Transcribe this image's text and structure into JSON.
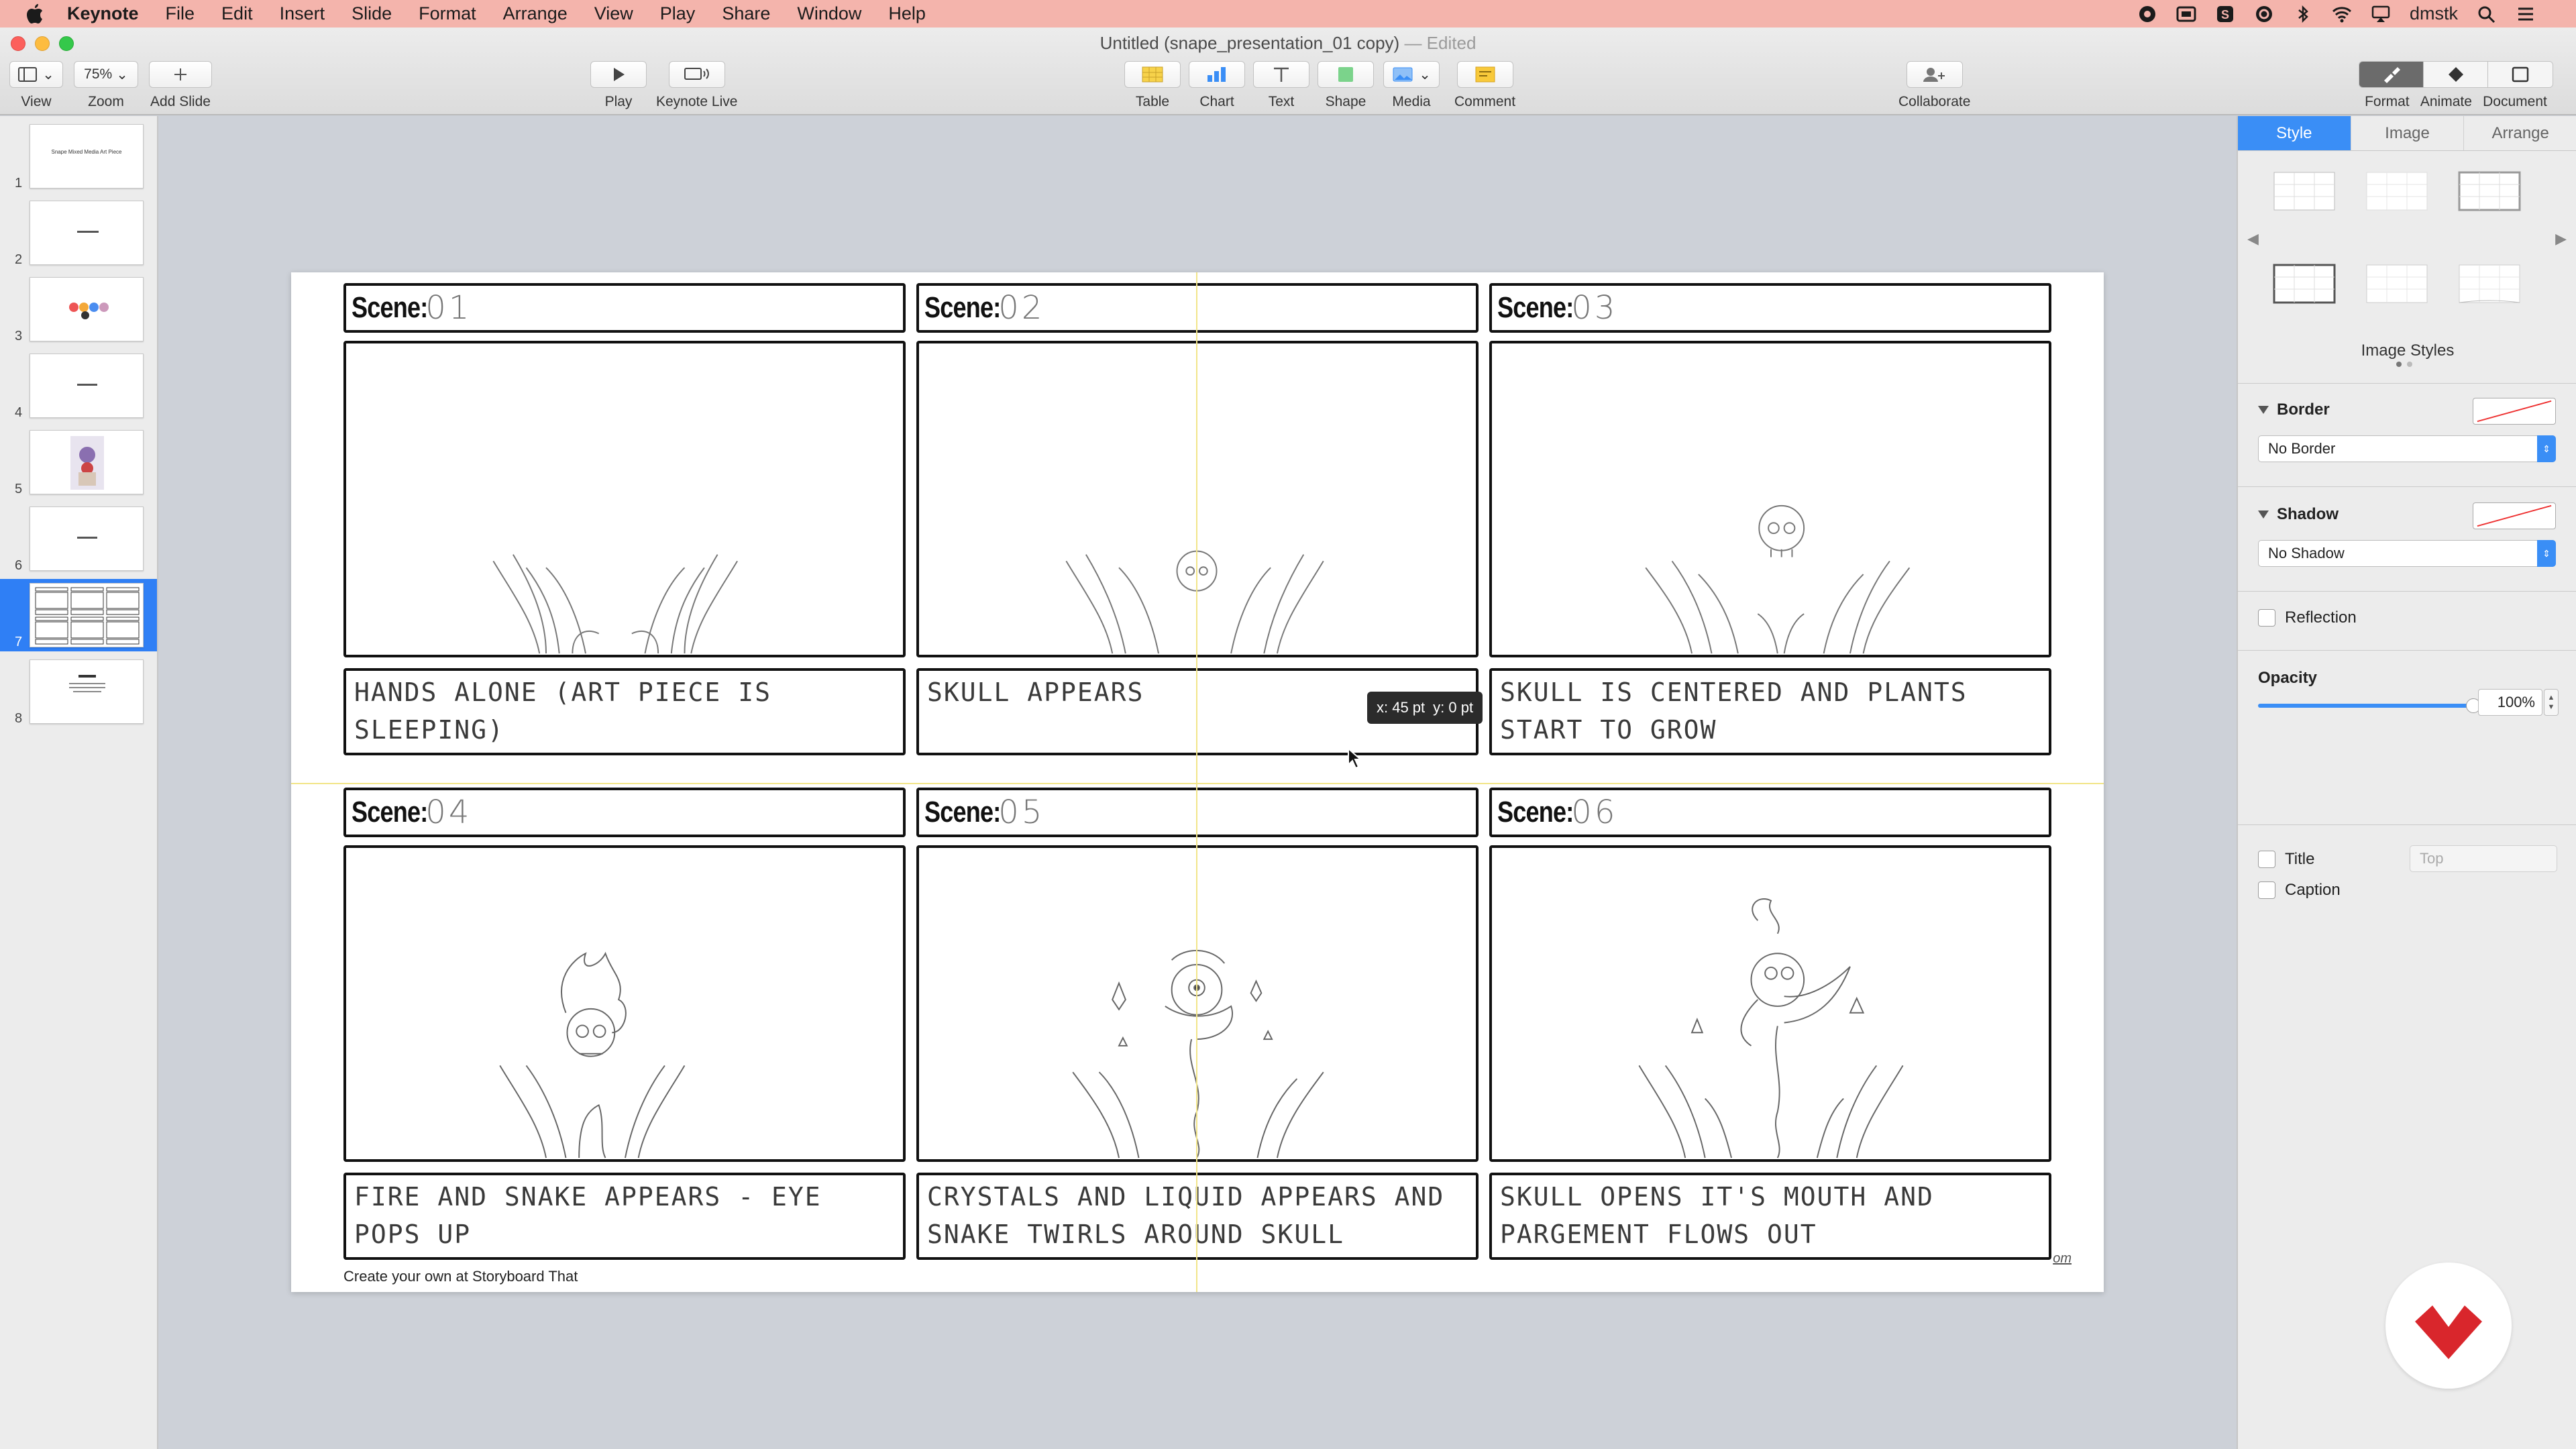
{
  "menubar": {
    "app_name": "Keynote",
    "items": [
      "File",
      "Edit",
      "Insert",
      "Slide",
      "Format",
      "Arrange",
      "View",
      "Play",
      "Share",
      "Window",
      "Help"
    ],
    "user": "dmstk"
  },
  "window": {
    "title": "Untitled (snape_presentation_01 copy)",
    "edited_suffix": "— Edited"
  },
  "toolbar": {
    "view_label": "View",
    "zoom_value": "75%",
    "zoom_label": "Zoom",
    "add_slide_label": "Add Slide",
    "play_label": "Play",
    "keynote_live_label": "Keynote Live",
    "table_label": "Table",
    "chart_label": "Chart",
    "text_label": "Text",
    "shape_label": "Shape",
    "media_label": "Media",
    "comment_label": "Comment",
    "collaborate_label": "Collaborate",
    "format_label": "Format",
    "animate_label": "Animate",
    "document_label": "Document"
  },
  "navigator": {
    "slides": [
      {
        "num": "1",
        "title": "Snape Mixed Media Art Piece"
      },
      {
        "num": "2",
        "title": ""
      },
      {
        "num": "3",
        "title": ""
      },
      {
        "num": "4",
        "title": ""
      },
      {
        "num": "5",
        "title": ""
      },
      {
        "num": "6",
        "title": ""
      },
      {
        "num": "7",
        "title": ""
      },
      {
        "num": "8",
        "title": ""
      }
    ],
    "selected_index": 6
  },
  "storyboard": {
    "scene_word": "Scene:",
    "scenes": [
      {
        "num": "01",
        "caption": "HANDS ALONE (ART PIECE IS SLEEPING)"
      },
      {
        "num": "02",
        "caption": "SKULL APPEARS"
      },
      {
        "num": "03",
        "caption": "SKULL IS CENTERED AND PLANTS START TO GROW"
      },
      {
        "num": "04",
        "caption": "FIRE AND SNAKE APPEARS - EYE POPS UP"
      },
      {
        "num": "05",
        "caption": "CRYSTALS AND LIQUID APPEARS AND SNAKE TWIRLS AROUND SKULL"
      },
      {
        "num": "06",
        "caption": "SKULL OPENS IT'S MOUTH AND PARGEMENT FLOWS OUT"
      }
    ],
    "footer": "Create your own at Storyboard That",
    "footer_mark": "om"
  },
  "tooltip": {
    "x": "x: 45 pt",
    "y": "y: 0 pt"
  },
  "inspector": {
    "tabs": [
      "Style",
      "Image",
      "Arrange"
    ],
    "active_tab": "Style",
    "image_styles_label": "Image Styles",
    "border_label": "Border",
    "border_value": "No Border",
    "shadow_label": "Shadow",
    "shadow_value": "No Shadow",
    "reflection_label": "Reflection",
    "opacity_label": "Opacity",
    "opacity_value": "100%",
    "opacity_fraction": 1.0,
    "title_label": "Title",
    "title_position": "Top",
    "caption_label": "Caption"
  },
  "colors": {
    "menubar": "#f4b4ac",
    "accent": "#3a8ef6",
    "guide": "#f2e58a",
    "brand_red": "#d9262c"
  }
}
